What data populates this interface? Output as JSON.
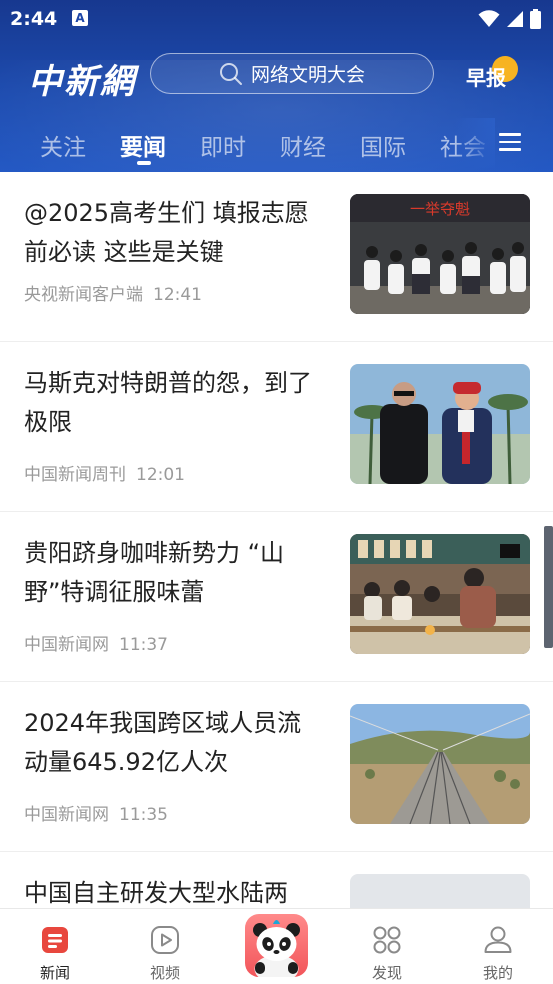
{
  "status_bar": {
    "time": "2:44",
    "notification_letter": "A"
  },
  "header": {
    "logo_text": "中新網",
    "search_placeholder": "网络文明大会",
    "zaobao_label": "早报"
  },
  "tabs": [
    {
      "label": "关注",
      "active": false
    },
    {
      "label": "要闻",
      "active": true
    },
    {
      "label": "即时",
      "active": false
    },
    {
      "label": "财经",
      "active": false
    },
    {
      "label": "国际",
      "active": false
    },
    {
      "label": "社会",
      "active": false
    }
  ],
  "articles": [
    {
      "title": "@2025高考生们 填报志愿前必读 这些是关键",
      "source": "央视新闻客户端",
      "time": "12:41",
      "thumb_banner_text": "一举夺魁"
    },
    {
      "title": "马斯克对特朗普的怨，到了极限",
      "source": "中国新闻周刊",
      "time": "12:01"
    },
    {
      "title": "贵阳跻身咖啡新势力 “山野”特调征服味蕾",
      "source": "中国新闻网",
      "time": "11:37"
    },
    {
      "title": "2024年我国跨区域人员流动量645.92亿人次",
      "source": "中国新闻网",
      "time": "11:35"
    },
    {
      "title": "中国自主研发大型水陆两",
      "source": "",
      "time": ""
    }
  ],
  "bottom_nav": [
    {
      "label": "新闻",
      "icon": "news-icon",
      "active": true
    },
    {
      "label": "视频",
      "icon": "video-icon",
      "active": false
    },
    {
      "label": "",
      "icon": "panda-icon",
      "active": false
    },
    {
      "label": "发现",
      "icon": "discover-icon",
      "active": false
    },
    {
      "label": "我的",
      "icon": "profile-icon",
      "active": false
    }
  ],
  "colors": {
    "header_top": "#17388f",
    "header_bottom": "#2459c4",
    "accent_red": "#e8473e",
    "zaobao_badge": "#f7b21d"
  }
}
